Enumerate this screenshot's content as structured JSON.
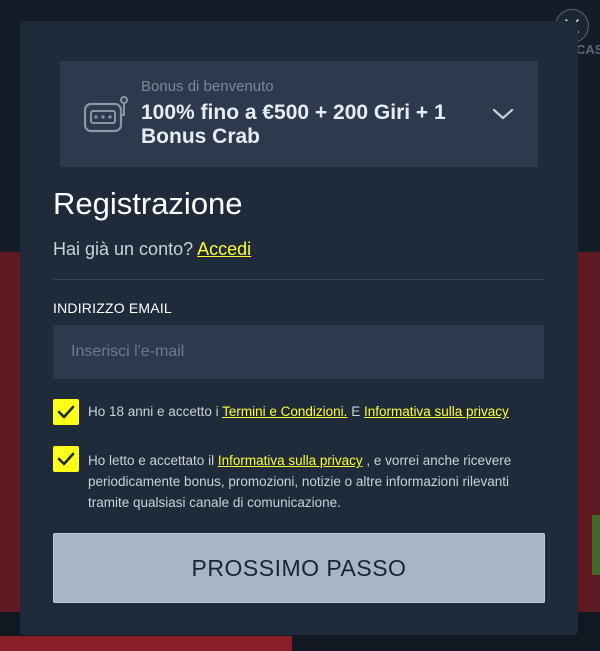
{
  "background": {
    "partial_label": "CAS"
  },
  "modal": {
    "bonus": {
      "subtitle": "Bonus di benvenuto",
      "title": "100% fino a €500 + 200 Giri + 1 Bonus Crab"
    },
    "heading": "Registrazione",
    "login_prompt": "Hai già un conto?",
    "login_link": "Accedi",
    "email": {
      "label": "INDIRIZZO EMAIL",
      "placeholder": "Inserisci l'e-mail",
      "value": ""
    },
    "checkbox_terms": {
      "checked": true,
      "prefix": "Ho 18 anni e accetto i",
      "link_terms": "Termini e Condizioni.",
      "conjunction": "E",
      "link_privacy": "Informativa sulla privacy"
    },
    "checkbox_marketing": {
      "checked": true,
      "prefix": "Ho letto e accettato il",
      "link_privacy": "Informativa sulla privacy",
      "suffix": ", e vorrei anche ricevere periodicamente bonus, promozioni, notizie o altre informazioni rilevanti tramite qualsiasi canale di comunicazione."
    },
    "next_button": "PROSSIMO PASSO"
  },
  "colors": {
    "modal_bg": "#1f2a3a",
    "card_bg": "#2d3a4e",
    "accent_yellow": "#ffff1a",
    "button_bg": "#a9b5c6"
  },
  "icons": {
    "close": "close-icon",
    "bonus": "slot-machine-icon",
    "expand": "chevron-down-icon",
    "check": "checkmark-icon"
  }
}
